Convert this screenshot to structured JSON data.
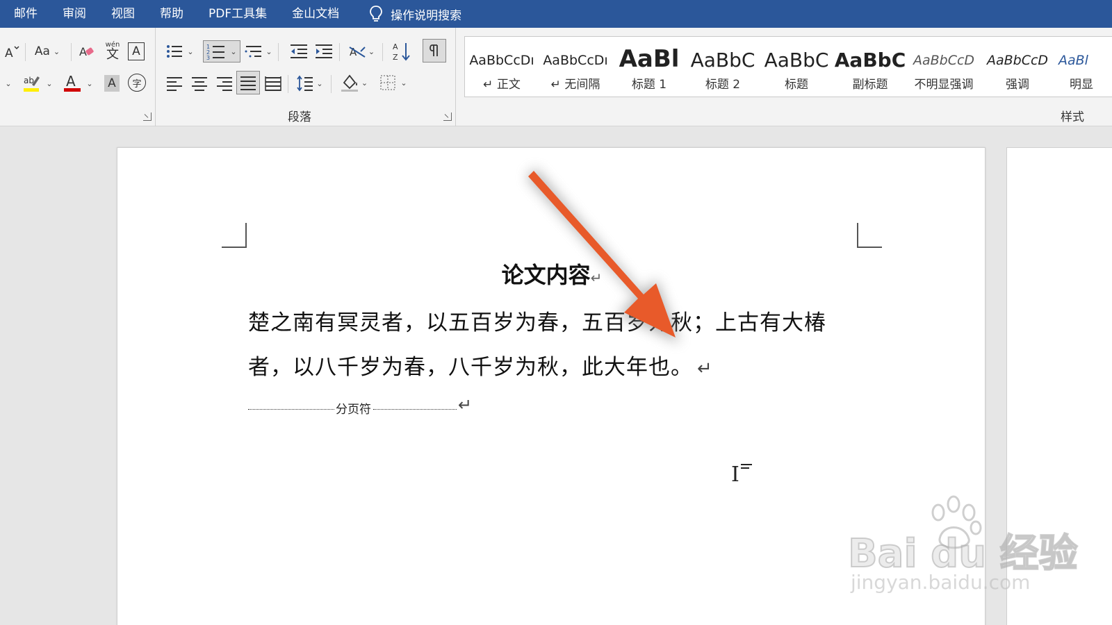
{
  "menu": {
    "items": [
      "邮件",
      "审阅",
      "视图",
      "帮助",
      "PDF工具集",
      "金山文档"
    ],
    "tell_me": "操作说明搜索"
  },
  "ribbon": {
    "font_group": {
      "font_size_btn": "Aa",
      "pinyin_glyph": "wén",
      "pinyin_char": "文",
      "char_border": "A",
      "font_color_glyph": "A",
      "shading_glyph": "A",
      "enclose_glyph": "字",
      "highlight_glyph": "ab"
    },
    "paragraph_group": {
      "label": "段落",
      "sort_glyph": "A↓Z"
    },
    "styles_group": {
      "label": "样式",
      "styles": [
        {
          "sample": "AaBbCcDı",
          "name": "↵ 正文"
        },
        {
          "sample": "AaBbCcDı",
          "name": "↵ 无间隔"
        },
        {
          "sample": "AaBl",
          "name": "标题 1"
        },
        {
          "sample": "AaBbC",
          "name": "标题 2"
        },
        {
          "sample": "AaBbC",
          "name": "标题"
        },
        {
          "sample": "AaBbC",
          "name": "副标题"
        },
        {
          "sample": "AaBbCcD",
          "name": "不明显强调"
        },
        {
          "sample": "AaBbCcD",
          "name": "强调"
        },
        {
          "sample": "AaBl",
          "name": "明显"
        }
      ]
    }
  },
  "document": {
    "title": "论文内容",
    "title_mark": "↵",
    "line1": "楚之南有冥灵者，以五百岁为春，五百岁为秋；上古有大椿",
    "line2": "者，以八千岁为春，八千岁为秋，此大年也。",
    "para_mark": "↵",
    "page_break": "分页符",
    "page_break_mark": "↵"
  },
  "watermark": {
    "brand": "Bai du 经验",
    "url": "jingyan.baidu.com"
  },
  "colors": {
    "title_bar": "#2b579a",
    "arrow": "#e85a2a",
    "font_color_underline": "#d00000",
    "highlight_underline": "#ffee00"
  }
}
